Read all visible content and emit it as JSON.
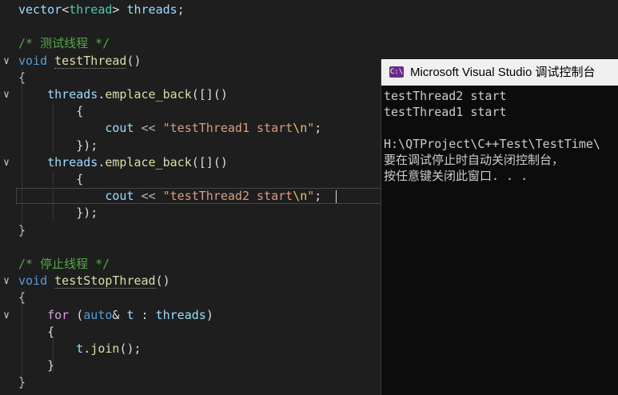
{
  "editor": {
    "lines": [
      [
        [
          "vector",
          "tok-var"
        ],
        [
          "<",
          "tok-punc"
        ],
        [
          "thread",
          "tok-type"
        ],
        [
          "> ",
          "tok-punc"
        ],
        [
          "threads",
          "tok-var"
        ],
        [
          ";",
          "tok-punc"
        ]
      ],
      [],
      [
        [
          "/* 测试线程 */",
          "tok-cmt"
        ]
      ],
      [
        [
          "void",
          "tok-kw"
        ],
        [
          " ",
          "tok-punc"
        ],
        [
          "testThread",
          "tok-fn tok-dotu"
        ],
        [
          "()",
          "tok-punc"
        ]
      ],
      [
        [
          "{",
          "tok-punc"
        ]
      ],
      [
        [
          "    ",
          "tok-punc"
        ],
        [
          "threads",
          "tok-var"
        ],
        [
          ".",
          "tok-punc"
        ],
        [
          "emplace_back",
          "tok-fn"
        ],
        [
          "([]()",
          "tok-punc"
        ]
      ],
      [
        [
          "        {",
          "tok-punc"
        ]
      ],
      [
        [
          "            ",
          "tok-punc"
        ],
        [
          "cout",
          "tok-var"
        ],
        [
          " << ",
          "tok-op"
        ],
        [
          "\"testThread1 start",
          "tok-str"
        ],
        [
          "\\n",
          "tok-esc"
        ],
        [
          "\"",
          "tok-str"
        ],
        [
          ";",
          "tok-punc"
        ]
      ],
      [
        [
          "        });",
          "tok-punc"
        ]
      ],
      [
        [
          "    ",
          "tok-punc"
        ],
        [
          "threads",
          "tok-var"
        ],
        [
          ".",
          "tok-punc"
        ],
        [
          "emplace_back",
          "tok-fn"
        ],
        [
          "([]()",
          "tok-punc"
        ]
      ],
      [
        [
          "        {",
          "tok-punc"
        ]
      ],
      [
        [
          "            ",
          "tok-punc"
        ],
        [
          "cout",
          "tok-var"
        ],
        [
          " << ",
          "tok-op"
        ],
        [
          "\"testThread2 start",
          "tok-str"
        ],
        [
          "\\n",
          "tok-esc"
        ],
        [
          "\"",
          "tok-str"
        ],
        [
          ";",
          "tok-punc"
        ]
      ],
      [
        [
          "        });",
          "tok-punc"
        ]
      ],
      [
        [
          "}",
          "tok-punc"
        ]
      ],
      [],
      [
        [
          "/* 停止线程 */",
          "tok-cmt"
        ]
      ],
      [
        [
          "void",
          "tok-kw"
        ],
        [
          " ",
          "tok-punc"
        ],
        [
          "testStopThread",
          "tok-fn tok-dotu"
        ],
        [
          "()",
          "tok-punc"
        ]
      ],
      [
        [
          "{",
          "tok-punc"
        ]
      ],
      [
        [
          "    ",
          "tok-punc"
        ],
        [
          "for",
          "tok-kw2"
        ],
        [
          " (",
          "tok-punc"
        ],
        [
          "auto",
          "tok-kw"
        ],
        [
          "& ",
          "tok-punc"
        ],
        [
          "t",
          "tok-var"
        ],
        [
          " : ",
          "tok-punc"
        ],
        [
          "threads",
          "tok-var"
        ],
        [
          ")",
          "tok-punc"
        ]
      ],
      [
        [
          "    {",
          "tok-punc"
        ]
      ],
      [
        [
          "        ",
          "tok-punc"
        ],
        [
          "t",
          "tok-var"
        ],
        [
          ".",
          "tok-punc"
        ],
        [
          "join",
          "tok-fn"
        ],
        [
          "();",
          "tok-punc"
        ]
      ],
      [
        [
          "    }",
          "tok-punc"
        ]
      ],
      [
        [
          "}",
          "tok-punc"
        ]
      ]
    ],
    "fold_markers": [
      "",
      "",
      "",
      "∨",
      "",
      "∨",
      "",
      "",
      "",
      "∨",
      "",
      "",
      "",
      "",
      "",
      "",
      "∨",
      "",
      "∨",
      "",
      "",
      "",
      ""
    ]
  },
  "console": {
    "title": "Microsoft Visual Studio 调试控制台",
    "icon_label": "C:\\",
    "output_lines": [
      "testThread2 start",
      "testThread1 start",
      "",
      "H:\\QTProject\\C++Test\\TestTime\\",
      "要在调试停止时自动关闭控制台，",
      "按任意键关闭此窗口. . ."
    ]
  }
}
